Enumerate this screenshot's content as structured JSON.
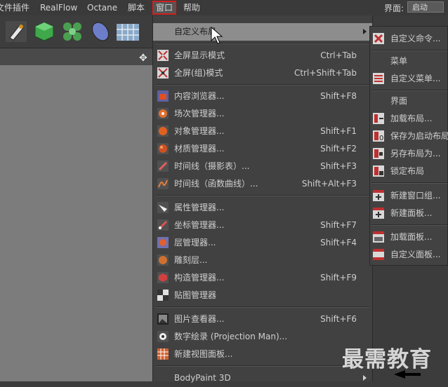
{
  "menubar": {
    "items": [
      "文件",
      "插件",
      "RealFlow",
      "Octane",
      "脚本",
      "窗口",
      "帮助"
    ],
    "active": "窗口",
    "layout_label": "界面:",
    "layout_value": "启动"
  },
  "toolbar": {
    "icons": [
      "pen-icon",
      "cube-icon",
      "cloner-icon",
      "deformer-icon",
      "floor-icon"
    ]
  },
  "menu": {
    "items": [
      {
        "label": "自定义布局",
        "shortcut": "",
        "icon": "none",
        "submenu": true,
        "highlight": true
      },
      {
        "label": "全屏显示模式",
        "shortcut": "Ctrl+Tab",
        "icon": "fullscreen-icon"
      },
      {
        "label": "全屏(组)模式",
        "shortcut": "Ctrl+Shift+Tab",
        "icon": "fullscreen-group-icon"
      },
      {
        "label": "内容浏览器...",
        "shortcut": "Shift+F8",
        "icon": "content-browser-icon"
      },
      {
        "label": "场次管理器...",
        "shortcut": "",
        "icon": "take-manager-icon"
      },
      {
        "label": "对象管理器...",
        "shortcut": "Shift+F1",
        "icon": "object-manager-icon"
      },
      {
        "label": "材质管理器...",
        "shortcut": "Shift+F2",
        "icon": "material-manager-icon"
      },
      {
        "label": "时间线（摄影表）...",
        "shortcut": "Shift+F3",
        "icon": "timeline-dopesheet-icon"
      },
      {
        "label": "时间线（函数曲线）...",
        "shortcut": "Shift+Alt+F3",
        "icon": "timeline-fcurve-icon"
      },
      {
        "label": "属性管理器...",
        "shortcut": "",
        "icon": "attribute-manager-icon"
      },
      {
        "label": "坐标管理器...",
        "shortcut": "Shift+F7",
        "icon": "coordinate-manager-icon"
      },
      {
        "label": "层管理器...",
        "shortcut": "Shift+F4",
        "icon": "layer-manager-icon"
      },
      {
        "label": "雕刻层...",
        "shortcut": "",
        "icon": "sculpt-layer-icon"
      },
      {
        "label": "构造管理器...",
        "shortcut": "Shift+F9",
        "icon": "structure-manager-icon"
      },
      {
        "label": "贴图管理器",
        "shortcut": "",
        "icon": "texture-manager-icon"
      },
      {
        "label": "图片查看器...",
        "shortcut": "Shift+F6",
        "icon": "picture-viewer-icon"
      },
      {
        "label": "数字绘录 (Projection Man)...",
        "shortcut": "",
        "icon": "projection-man-icon"
      },
      {
        "label": "新建视图面板...",
        "shortcut": "",
        "icon": "new-view-panel-icon"
      },
      {
        "label": "BodyPaint 3D",
        "shortcut": "",
        "icon": "none",
        "submenu": true
      }
    ]
  },
  "submenu": {
    "items": [
      {
        "label": "自定义命令...",
        "icon": "customize-commands-icon"
      },
      {
        "label": "菜单",
        "icon": "none"
      },
      {
        "label": "自定义菜单...",
        "icon": "customize-menus-icon"
      },
      {
        "label": "界面",
        "icon": "none"
      },
      {
        "label": "加载布局...",
        "icon": "load-layout-icon"
      },
      {
        "label": "保存为启动布局",
        "icon": "save-startup-layout-icon"
      },
      {
        "label": "另存布局为...",
        "icon": "save-layout-as-icon"
      },
      {
        "label": "锁定布局",
        "icon": "lock-layout-icon"
      },
      {
        "label": "新建窗口组...",
        "icon": "new-window-group-icon"
      },
      {
        "label": "新建面板...",
        "icon": "new-panel-icon"
      },
      {
        "label": "加载面板...",
        "icon": "load-panel-icon"
      },
      {
        "label": "自定义面板...",
        "icon": "custom-panel-icon"
      }
    ]
  },
  "watermark": "最需教育",
  "colors": {
    "highlight": "#8d8d8d",
    "menu_bg": "#414141",
    "active_outline": "#d02020"
  }
}
